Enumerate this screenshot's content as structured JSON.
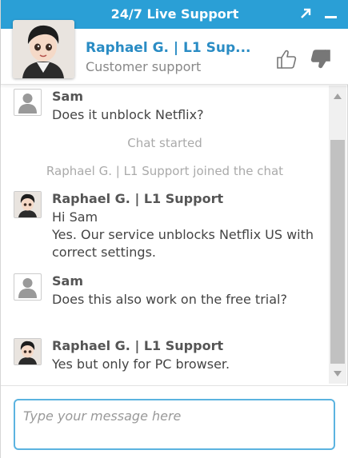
{
  "widget": {
    "title": "24/7 Live Support",
    "accent": "#2a9fd6"
  },
  "agent": {
    "name": "Raphael G. | L1 Sup...",
    "role": "Customer support"
  },
  "messages": [
    {
      "sender": "Sam",
      "text": "Does it unblock Netflix?",
      "avatar": "user-silhouette-icon"
    },
    {
      "system": "Chat started"
    },
    {
      "system": "Raphael G. | L1 Support joined the chat"
    },
    {
      "sender": "Raphael G. | L1 Support",
      "lines": [
        "Hi Sam",
        "Yes. Our service unblocks Netflix US with correct settings."
      ],
      "avatar": "agent-avatar"
    },
    {
      "sender": "Sam",
      "text": "Does this also work on the free trial?",
      "avatar": "user-silhouette-icon"
    },
    {
      "sender": "Raphael G. | L1 Support",
      "text": "Yes but only for PC browser.",
      "avatar": "agent-avatar"
    }
  ],
  "composer": {
    "placeholder": "Type your message here"
  }
}
